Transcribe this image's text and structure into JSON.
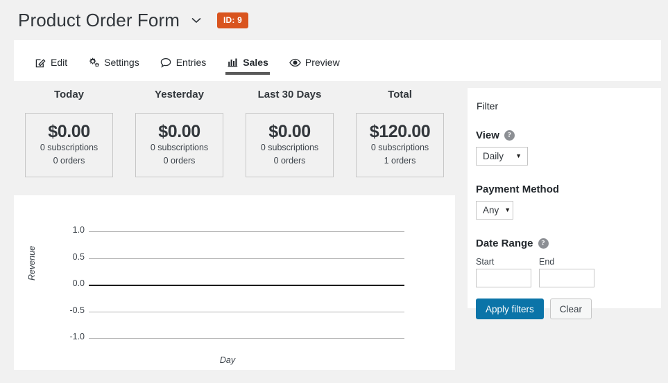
{
  "header": {
    "form_title": "Product Order Form",
    "caret_icon": "chevron-down-icon",
    "id_badge": "ID: 9",
    "badge_color": "#d9541e"
  },
  "tabs": [
    {
      "label": "Edit",
      "icon": "pencil-square-icon",
      "active": false
    },
    {
      "label": "Settings",
      "icon": "gears-icon",
      "active": false
    },
    {
      "label": "Entries",
      "icon": "speech-bubble-icon",
      "active": false
    },
    {
      "label": "Sales",
      "icon": "bar-chart-icon",
      "active": true
    },
    {
      "label": "Preview",
      "icon": "eye-icon",
      "active": false
    }
  ],
  "stats": [
    {
      "heading": "Today",
      "amount": "$0.00",
      "subscriptions": "0 subscriptions",
      "orders": "0 orders"
    },
    {
      "heading": "Yesterday",
      "amount": "$0.00",
      "subscriptions": "0 subscriptions",
      "orders": "0 orders"
    },
    {
      "heading": "Last 30 Days",
      "amount": "$0.00",
      "subscriptions": "0 subscriptions",
      "orders": "0 orders"
    },
    {
      "heading": "Total",
      "amount": "$120.00",
      "subscriptions": "0 subscriptions",
      "orders": "1 orders"
    }
  ],
  "filter": {
    "title": "Filter",
    "view_label": "View",
    "view_help_icon": "question-mark-icon",
    "view_value": "Daily",
    "payment_label": "Payment Method",
    "payment_value": "Any",
    "date_range_label": "Date Range",
    "date_range_help_icon": "question-mark-icon",
    "start_label": "Start",
    "start_value": "",
    "start_placeholder": "",
    "end_label": "End",
    "end_value": "",
    "end_placeholder": "",
    "apply_label": "Apply filters",
    "clear_label": "Clear",
    "apply_color": "#0b74a8"
  },
  "chart_data": {
    "type": "line",
    "title": "",
    "xlabel": "Day",
    "ylabel": "Revenue",
    "x": [],
    "values": [],
    "series": [
      {
        "name": "Revenue",
        "values": []
      }
    ],
    "ytick_labels": [
      "1.0",
      "0.5",
      "0.0",
      "-0.5",
      "-1.0"
    ],
    "yticks": [
      1.0,
      0.5,
      0.0,
      -0.5,
      -1.0
    ],
    "xtick_labels": [],
    "ylim": [
      -1.2,
      1.2
    ],
    "grid": true,
    "legend": false,
    "zero_line_emphasis": true
  }
}
